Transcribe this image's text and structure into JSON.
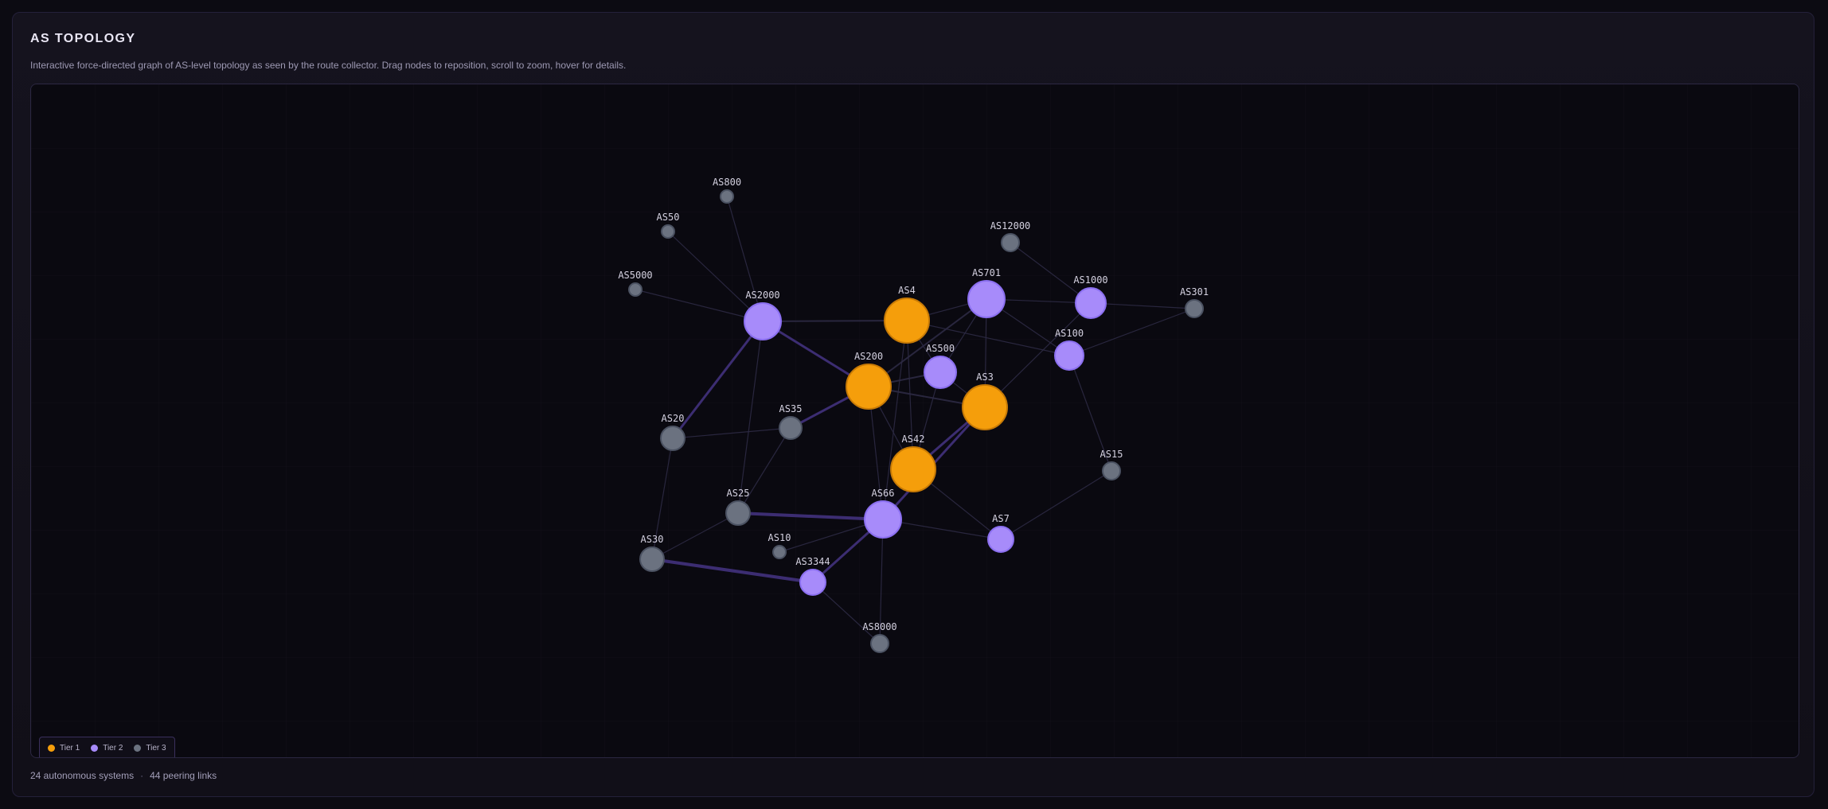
{
  "header": {
    "title": "AS TOPOLOGY",
    "description": "Interactive force-directed graph of AS-level topology as seen by the route collector. Drag nodes to reposition, scroll to zoom, hover for details."
  },
  "colors": {
    "tier1": "#f59e0b",
    "tier2": "#a78bfa",
    "tier3": "#6b7280"
  },
  "legend": [
    {
      "label": "Tier 1",
      "tier": 1
    },
    {
      "label": "Tier 2",
      "tier": 2
    },
    {
      "label": "Tier 3",
      "tier": 3
    }
  ],
  "graph": {
    "nodes": [
      {
        "id": "AS4",
        "tier": 1
      },
      {
        "id": "AS200",
        "tier": 1
      },
      {
        "id": "AS3",
        "tier": 1
      },
      {
        "id": "AS42",
        "tier": 1
      },
      {
        "id": "AS2000",
        "tier": 2
      },
      {
        "id": "AS701",
        "tier": 2
      },
      {
        "id": "AS1000",
        "tier": 2
      },
      {
        "id": "AS100",
        "tier": 2
      },
      {
        "id": "AS500",
        "tier": 2
      },
      {
        "id": "AS66",
        "tier": 2
      },
      {
        "id": "AS7",
        "tier": 2
      },
      {
        "id": "AS3344",
        "tier": 2
      },
      {
        "id": "AS800",
        "tier": 3
      },
      {
        "id": "AS50",
        "tier": 3
      },
      {
        "id": "AS5000",
        "tier": 3
      },
      {
        "id": "AS12000",
        "tier": 3
      },
      {
        "id": "AS301",
        "tier": 3
      },
      {
        "id": "AS20",
        "tier": 3
      },
      {
        "id": "AS35",
        "tier": 3
      },
      {
        "id": "AS15",
        "tier": 3
      },
      {
        "id": "AS25",
        "tier": 3
      },
      {
        "id": "AS10",
        "tier": 3
      },
      {
        "id": "AS30",
        "tier": 3
      },
      {
        "id": "AS8000",
        "tier": 3
      }
    ],
    "links": [
      [
        "AS800",
        "AS2000",
        1
      ],
      [
        "AS50",
        "AS2000",
        1
      ],
      [
        "AS5000",
        "AS2000",
        1
      ],
      [
        "AS2000",
        "AS4",
        2
      ],
      [
        "AS2000",
        "AS200",
        3
      ],
      [
        "AS2000",
        "AS20",
        3
      ],
      [
        "AS2000",
        "AS25",
        1
      ],
      [
        "AS12000",
        "AS1000",
        1
      ],
      [
        "AS701",
        "AS1000",
        1
      ],
      [
        "AS1000",
        "AS301",
        1
      ],
      [
        "AS301",
        "AS100",
        1
      ],
      [
        "AS4",
        "AS701",
        1
      ],
      [
        "AS4",
        "AS500",
        1
      ],
      [
        "AS4",
        "AS100",
        1
      ],
      [
        "AS4",
        "AS42",
        1
      ],
      [
        "AS4",
        "AS66",
        1
      ],
      [
        "AS701",
        "AS200",
        2
      ],
      [
        "AS701",
        "AS500",
        1
      ],
      [
        "AS701",
        "AS3",
        1
      ],
      [
        "AS701",
        "AS100",
        1
      ],
      [
        "AS1000",
        "AS3",
        1
      ],
      [
        "AS200",
        "AS500",
        2
      ],
      [
        "AS200",
        "AS3",
        2
      ],
      [
        "AS200",
        "AS42",
        1
      ],
      [
        "AS200",
        "AS35",
        3
      ],
      [
        "AS200",
        "AS66",
        1
      ],
      [
        "AS500",
        "AS3",
        1
      ],
      [
        "AS500",
        "AS42",
        1
      ],
      [
        "AS3",
        "AS42",
        3
      ],
      [
        "AS3",
        "AS66",
        3
      ],
      [
        "AS100",
        "AS15",
        1
      ],
      [
        "AS20",
        "AS35",
        1
      ],
      [
        "AS20",
        "AS30",
        1
      ],
      [
        "AS35",
        "AS25",
        1
      ],
      [
        "AS42",
        "AS7",
        1
      ],
      [
        "AS25",
        "AS66",
        4
      ],
      [
        "AS25",
        "AS30",
        1
      ],
      [
        "AS66",
        "AS7",
        1
      ],
      [
        "AS66",
        "AS10",
        1
      ],
      [
        "AS66",
        "AS3344",
        3
      ],
      [
        "AS66",
        "AS8000",
        1
      ],
      [
        "AS15",
        "AS7",
        1
      ],
      [
        "AS30",
        "AS3344",
        4
      ],
      [
        "AS3344",
        "AS8000",
        1
      ]
    ]
  },
  "footer": {
    "systems": "24 autonomous systems",
    "separator": "·",
    "links": "44 peering links"
  }
}
